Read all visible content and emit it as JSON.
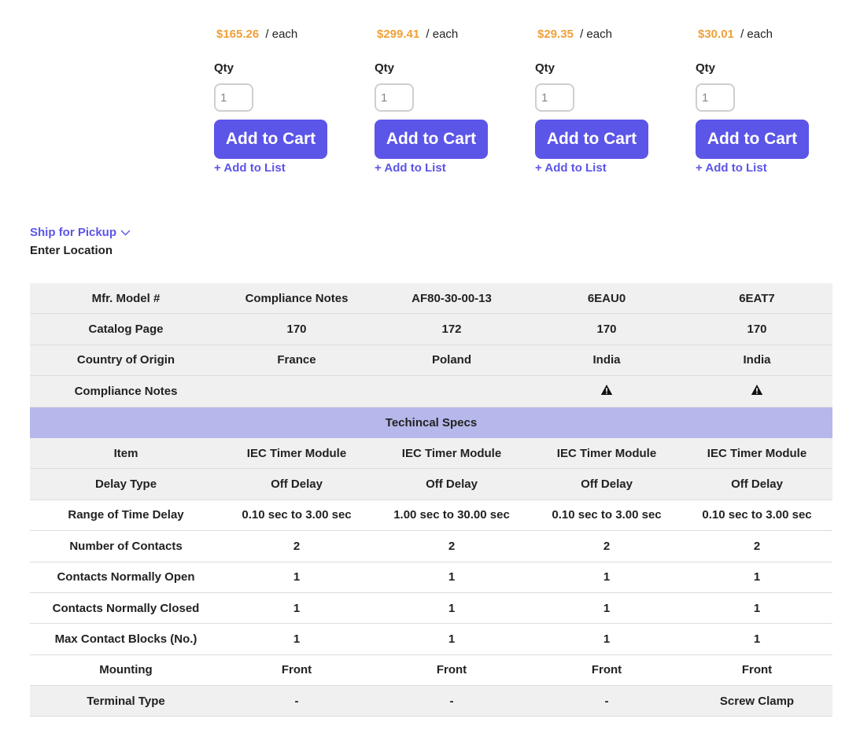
{
  "products": [
    {
      "price": "$165.26",
      "per": "/ each",
      "qty_label": "Qty",
      "qty_value": "1",
      "cart_label": "Add to Cart",
      "list_label": "+ Add to List"
    },
    {
      "price": "$299.41",
      "per": "/ each",
      "qty_label": "Qty",
      "qty_value": "1",
      "cart_label": "Add to Cart",
      "list_label": "+ Add to List"
    },
    {
      "price": "$29.35",
      "per": "/ each",
      "qty_label": "Qty",
      "qty_value": "1",
      "cart_label": "Add to Cart",
      "list_label": "+ Add to List"
    },
    {
      "price": "$30.01",
      "per": "/ each",
      "qty_label": "Qty",
      "qty_value": "1",
      "cart_label": "Add to Cart",
      "list_label": "+ Add to List"
    }
  ],
  "pickup": {
    "ship_label": "Ship for Pickup",
    "location_label": "Enter Location"
  },
  "colors": {
    "accent": "#5b55e8",
    "price": "#f0a03a",
    "section_bg": "#b6b7ea",
    "row_shade": "#f0f0f0"
  },
  "spec_rows": [
    {
      "label": "Mfr. Model #",
      "values": [
        "Compliance Notes",
        "AF80-30-00-13",
        "6EAU0",
        "6EAT7"
      ]
    },
    {
      "label": "Catalog Page",
      "values": [
        "170",
        "172",
        "170",
        "170"
      ]
    },
    {
      "label": "Country of Origin",
      "values": [
        "France",
        "Poland",
        "India",
        "India"
      ]
    },
    {
      "label": "Compliance Notes",
      "values": [
        "",
        "",
        "warning-icon",
        "warning-icon"
      ]
    }
  ],
  "section_title": "Techincal Specs",
  "tech_rows": [
    {
      "label": "Item",
      "values": [
        "IEC Timer Module",
        "IEC Timer Module",
        "IEC Timer Module",
        "IEC Timer Module"
      ]
    },
    {
      "label": "Delay Type",
      "values": [
        "Off Delay",
        "Off Delay",
        "Off Delay",
        "Off Delay"
      ]
    },
    {
      "label": "Range of Time Delay",
      "values": [
        "0.10 sec to 3.00 sec",
        "1.00 sec to 30.00 sec",
        "0.10 sec to 3.00 sec",
        "0.10 sec to 3.00 sec"
      ]
    },
    {
      "label": "Number of Contacts",
      "values": [
        "2",
        "2",
        "2",
        "2"
      ]
    },
    {
      "label": "Contacts Normally Open",
      "values": [
        "1",
        "1",
        "1",
        "1"
      ]
    },
    {
      "label": "Contacts Normally Closed",
      "values": [
        "1",
        "1",
        "1",
        "1"
      ]
    },
    {
      "label": "Max Contact Blocks (No.)",
      "values": [
        "1",
        "1",
        "1",
        "1"
      ]
    },
    {
      "label": "Mounting",
      "values": [
        "Front",
        "Front",
        "Front",
        "Front"
      ]
    },
    {
      "label": "Terminal Type",
      "values": [
        "-",
        "-",
        "-",
        "Screw Clamp"
      ]
    }
  ]
}
